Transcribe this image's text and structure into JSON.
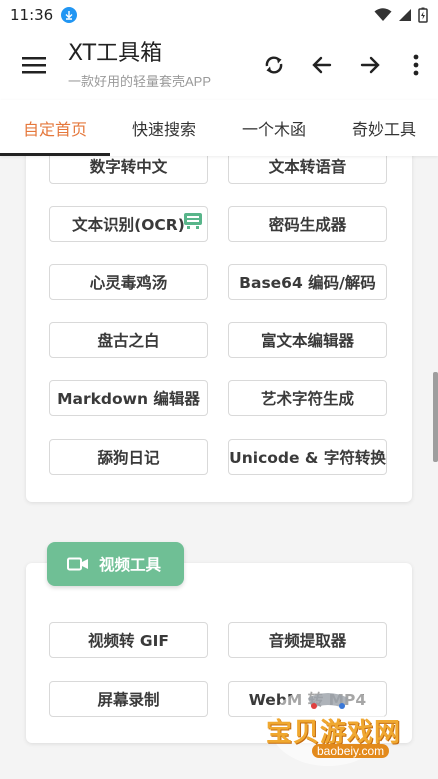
{
  "status_bar": {
    "time": "11:36"
  },
  "app_bar": {
    "title": "XT工具箱",
    "subtitle": "一款好用的轻量套壳APP"
  },
  "tabs": [
    {
      "label": "自定首页",
      "active": true
    },
    {
      "label": "快速搜索",
      "active": false
    },
    {
      "label": "一个木函",
      "active": false
    },
    {
      "label": "奇妙工具",
      "active": false
    }
  ],
  "tools_card": {
    "rows": [
      [
        "数字转中文",
        "文本转语音"
      ],
      [
        "文本识别(OCR)",
        "密码生成器"
      ],
      [
        "心灵毒鸡汤",
        "Base64 编码/解码"
      ],
      [
        "盘古之白",
        "富文本编辑器"
      ],
      [
        "Markdown 编辑器",
        "艺术字符生成"
      ],
      [
        "舔狗日记",
        "Unicode & 字符转换"
      ]
    ]
  },
  "video_section": {
    "title": "视频工具",
    "icon": "video-camera-icon",
    "rows": [
      [
        "视频转 GIF",
        "音频提取器"
      ],
      [
        "屏幕录制",
        "WebM 转 MP4"
      ]
    ]
  },
  "watermark": {
    "text": "宝贝游戏网",
    "url": "baobeiy.com"
  },
  "colors": {
    "accent": "#e5783c",
    "section_green": "#6fbf95",
    "background": "#f4f4f4"
  }
}
